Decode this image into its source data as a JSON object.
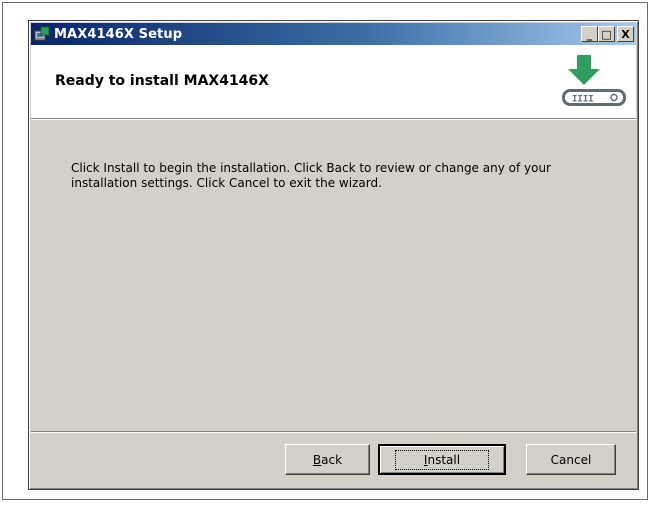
{
  "window": {
    "title": "MAX4146X Setup",
    "controls": {
      "minimize": "_",
      "maximize": "□",
      "close": "X"
    }
  },
  "header": {
    "title": "Ready to install MAX4146X",
    "graphic_icon": "download-to-drive-icon",
    "graphic_label": "IIII"
  },
  "body": {
    "text": "Click Install to begin the installation. Click Back to review or change any of your installation settings. Click Cancel to exit the wizard."
  },
  "buttons": {
    "back": {
      "mnemonic": "B",
      "rest": "ack"
    },
    "install": {
      "mnemonic": "I",
      "rest": "nstall"
    },
    "cancel": "Cancel"
  },
  "colors": {
    "titlebar_start": "#0a246a",
    "titlebar_end": "#a6caf0",
    "dialog_face": "#d4d0c8",
    "arrow_green": "#2e9e5f",
    "drive_gray": "#5f6b6e"
  }
}
